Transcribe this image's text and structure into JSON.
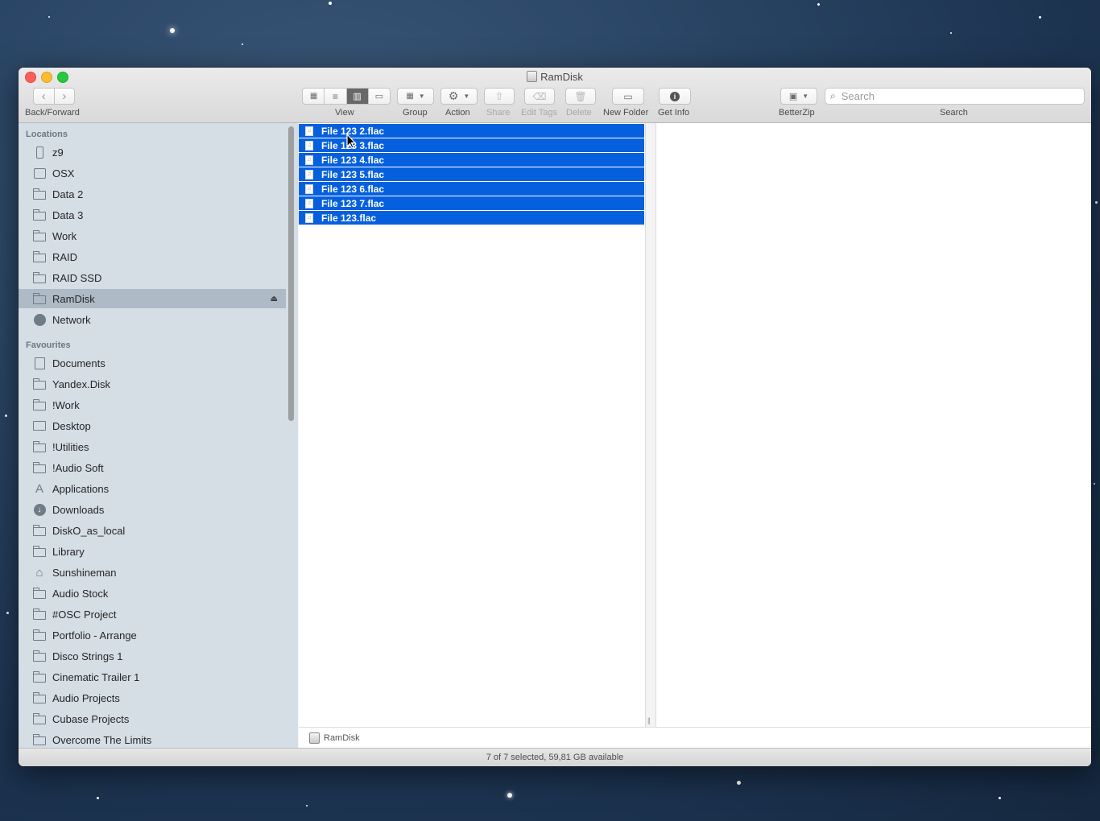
{
  "window": {
    "title": "RamDisk"
  },
  "toolbar": {
    "back_forward_label": "Back/Forward",
    "view_label": "View",
    "group_label": "Group",
    "action_label": "Action",
    "share_label": "Share",
    "edit_tags_label": "Edit Tags",
    "delete_label": "Delete",
    "new_folder_label": "New Folder",
    "get_info_label": "Get Info",
    "betterzip_label": "BetterZip",
    "search_label": "Search",
    "search_placeholder": "Search",
    "active_view": "columns"
  },
  "sidebar": {
    "locations_header": "Locations",
    "locations": [
      {
        "label": "z9",
        "icon": "external-drive-icon"
      },
      {
        "label": "OSX",
        "icon": "internal-disk-icon"
      },
      {
        "label": "Data 2",
        "icon": "folder-icon"
      },
      {
        "label": "Data 3",
        "icon": "folder-icon"
      },
      {
        "label": "Work",
        "icon": "folder-icon"
      },
      {
        "label": "RAID",
        "icon": "folder-icon"
      },
      {
        "label": "RAID SSD",
        "icon": "folder-icon"
      },
      {
        "label": "RamDisk",
        "icon": "folder-icon",
        "selected": true
      },
      {
        "label": "Network",
        "icon": "globe-icon"
      }
    ],
    "favourites_header": "Favourites",
    "favourites": [
      {
        "label": "Documents",
        "icon": "documents-icon"
      },
      {
        "label": "Yandex.Disk",
        "icon": "folder-icon"
      },
      {
        "label": "!Work",
        "icon": "folder-icon"
      },
      {
        "label": "Desktop",
        "icon": "desktop-icon"
      },
      {
        "label": "!Utilities",
        "icon": "folder-icon"
      },
      {
        "label": "!Audio Soft",
        "icon": "folder-icon"
      },
      {
        "label": "Applications",
        "icon": "applications-icon"
      },
      {
        "label": "Downloads",
        "icon": "downloads-icon"
      },
      {
        "label": "DiskO_as_local",
        "icon": "folder-icon"
      },
      {
        "label": "Library",
        "icon": "folder-icon"
      },
      {
        "label": "Sunshineman",
        "icon": "home-icon"
      },
      {
        "label": "Audio Stock",
        "icon": "folder-icon"
      },
      {
        "label": "#OSC Project",
        "icon": "folder-icon"
      },
      {
        "label": "Portfolio - Arrange",
        "icon": "folder-icon"
      },
      {
        "label": "Disco Strings 1",
        "icon": "folder-icon"
      },
      {
        "label": "Cinematic Trailer 1",
        "icon": "folder-icon"
      },
      {
        "label": "Audio Projects",
        "icon": "folder-icon"
      },
      {
        "label": "Cubase Projects",
        "icon": "folder-icon"
      },
      {
        "label": "Overcome The Limits",
        "icon": "folder-icon"
      }
    ]
  },
  "files": [
    "File 123 2.flac",
    "File 123 3.flac",
    "File 123 4.flac",
    "File 123 5.flac",
    "File 123 6.flac",
    "File 123 7.flac",
    "File 123.flac"
  ],
  "pathbar": {
    "label": "RamDisk"
  },
  "status": {
    "text": "7 of 7 selected, 59,81 GB available"
  },
  "colors": {
    "selection": "#0660dd",
    "sidebar_bg": "#d3dce4"
  }
}
